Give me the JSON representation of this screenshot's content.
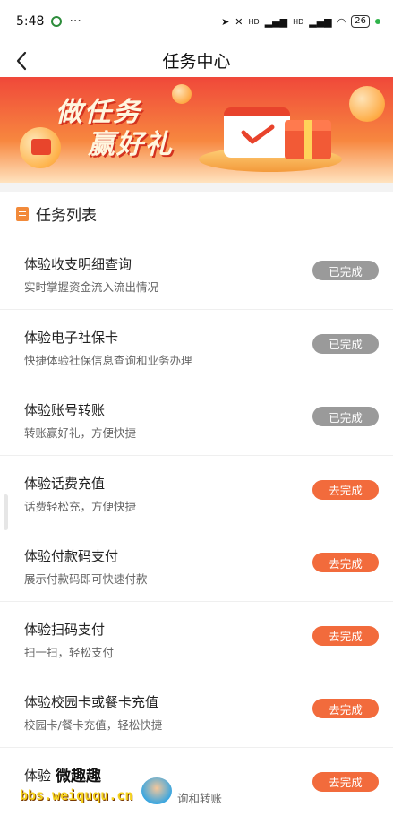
{
  "status_bar": {
    "time": "5:48",
    "dots": "···",
    "signal_label_1": "HD",
    "signal_label_2": "HD",
    "battery": "26"
  },
  "nav": {
    "title": "任务中心",
    "back_icon": "chevron-left-icon"
  },
  "banner": {
    "line1": "做任务",
    "line2": "赢好礼"
  },
  "section": {
    "title": "任务列表"
  },
  "tasks": [
    {
      "title": "体验收支明细查询",
      "desc": "实时掌握资金流入流出情况",
      "button": "已完成",
      "state": "done"
    },
    {
      "title": "体验电子社保卡",
      "desc": "快捷体验社保信息查询和业务办理",
      "button": "已完成",
      "state": "done"
    },
    {
      "title": "体验账号转账",
      "desc": "转账赢好礼，方便快捷",
      "button": "已完成",
      "state": "done"
    },
    {
      "title": "体验话费充值",
      "desc": "话费轻松充，方便快捷",
      "button": "去完成",
      "state": "todo"
    },
    {
      "title": "体验付款码支付",
      "desc": "展示付款码即可快速付款",
      "button": "去完成",
      "state": "todo"
    },
    {
      "title": "体验扫码支付",
      "desc": "扫一扫，轻松支付",
      "button": "去完成",
      "state": "todo"
    },
    {
      "title": "体验校园卡或餐卡充值",
      "desc": "校园卡/餐卡充值，轻松快捷",
      "button": "去完成",
      "state": "todo"
    },
    {
      "title": "体验",
      "desc": "询和转账",
      "button": "去完成",
      "state": "todo"
    }
  ],
  "watermark": {
    "top": "微趣趣",
    "url": "bbs.weiququ.cn"
  },
  "colors": {
    "done_button": "#9a9a9a",
    "todo_button": "#f26b3c",
    "banner_red": "#f0483a"
  }
}
